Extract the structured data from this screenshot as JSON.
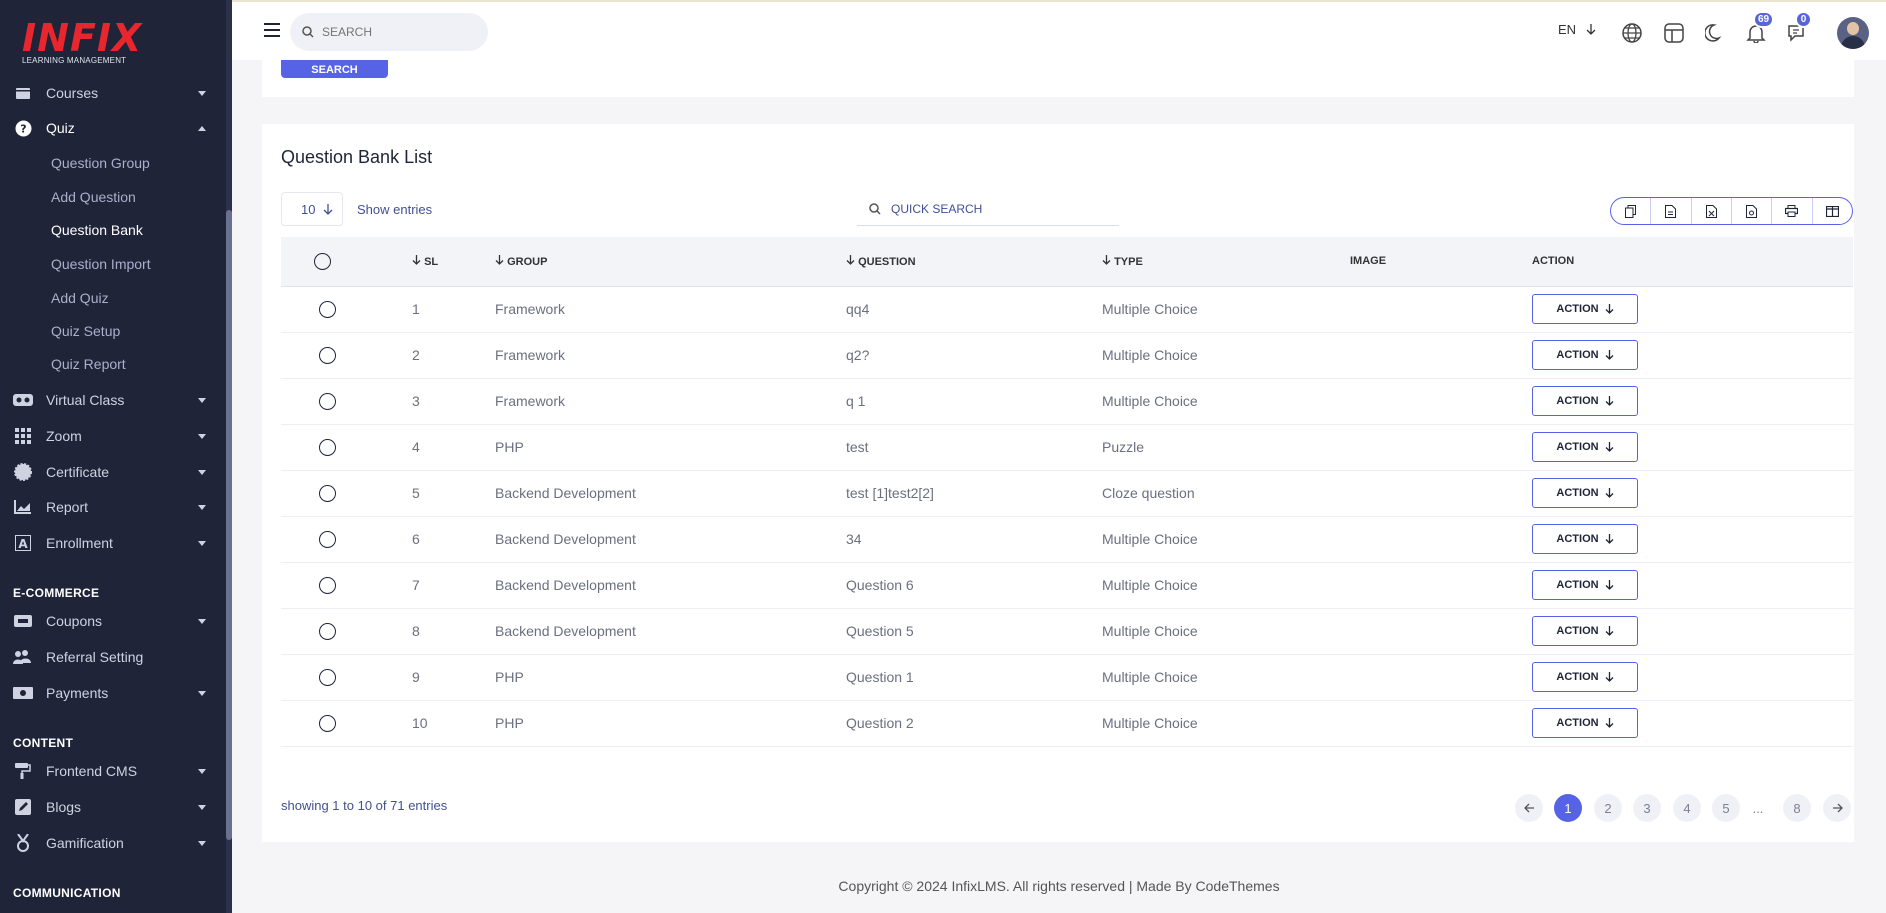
{
  "brand": {
    "logo_text": "INFIX",
    "logo_sub": "LEARNING MANAGEMENT"
  },
  "sidebar": {
    "items": [
      {
        "label": "Courses",
        "icon": "book-icon"
      },
      {
        "label": "Quiz",
        "icon": "question-icon"
      },
      {
        "label": "Virtual Class",
        "icon": "vr-icon"
      },
      {
        "label": "Zoom",
        "icon": "grid-icon"
      },
      {
        "label": "Certificate",
        "icon": "certificate-icon"
      },
      {
        "label": "Report",
        "icon": "chart-icon"
      },
      {
        "label": "Enrollment",
        "icon": "enrollment-icon"
      },
      {
        "label": "Coupons",
        "icon": "coupon-icon"
      },
      {
        "label": "Referral Setting",
        "icon": "users-icon"
      },
      {
        "label": "Payments",
        "icon": "money-icon"
      },
      {
        "label": "Frontend CMS",
        "icon": "paint-roller-icon"
      },
      {
        "label": "Blogs",
        "icon": "edit-icon"
      },
      {
        "label": "Gamification",
        "icon": "medal-icon"
      }
    ],
    "quiz_sub": [
      {
        "label": "Question Group"
      },
      {
        "label": "Add Question"
      },
      {
        "label": "Question Bank"
      },
      {
        "label": "Question Import"
      },
      {
        "label": "Add Quiz"
      },
      {
        "label": "Quiz Setup"
      },
      {
        "label": "Quiz Report"
      }
    ],
    "sections": {
      "ecommerce": "E-COMMERCE",
      "content": "CONTENT",
      "communication": "COMMUNICATION"
    }
  },
  "header": {
    "search_placeholder": "SEARCH",
    "language": "EN",
    "notifications_count": "69",
    "messages_count": "0"
  },
  "top_card": {
    "search_button": "SEARCH"
  },
  "main": {
    "title": "Question Bank List",
    "entries_value": "10",
    "show_entries": "Show entries",
    "quick_search_placeholder": "QUICK SEARCH",
    "columns": [
      "SL",
      "GROUP",
      "QUESTION",
      "TYPE",
      "IMAGE",
      "ACTION"
    ],
    "action_label": "ACTION",
    "rows": [
      {
        "sl": "1",
        "group": "Framework",
        "question": "qq4",
        "type": "Multiple Choice"
      },
      {
        "sl": "2",
        "group": "Framework",
        "question": "q2?",
        "type": "Multiple Choice"
      },
      {
        "sl": "3",
        "group": "Framework",
        "question": "q 1",
        "type": "Multiple Choice"
      },
      {
        "sl": "4",
        "group": "PHP",
        "question": "test",
        "type": "Puzzle"
      },
      {
        "sl": "5",
        "group": "Backend Development",
        "question": "test [1]test2[2]",
        "type": "Cloze question"
      },
      {
        "sl": "6",
        "group": "Backend Development",
        "question": "34",
        "type": "Multiple Choice"
      },
      {
        "sl": "7",
        "group": "Backend Development",
        "question": "Question 6",
        "type": "Multiple Choice"
      },
      {
        "sl": "8",
        "group": "Backend Development",
        "question": "Question 5",
        "type": "Multiple Choice"
      },
      {
        "sl": "9",
        "group": "PHP",
        "question": "Question 1",
        "type": "Multiple Choice"
      },
      {
        "sl": "10",
        "group": "PHP",
        "question": "Question 2",
        "type": "Multiple Choice"
      }
    ],
    "showing": "showing 1 to 10 of 71 entries",
    "pages": [
      "1",
      "2",
      "3",
      "4",
      "5",
      "...",
      "8"
    ],
    "current_page": "1"
  },
  "footer": {
    "text": "Copyright © 2024 InfixLMS. All rights reserved | Made By CodeThemes"
  },
  "colors": {
    "sidebar_bg": "#1f2438",
    "accent": "#5763e6",
    "brand_red": "#e8262e"
  }
}
